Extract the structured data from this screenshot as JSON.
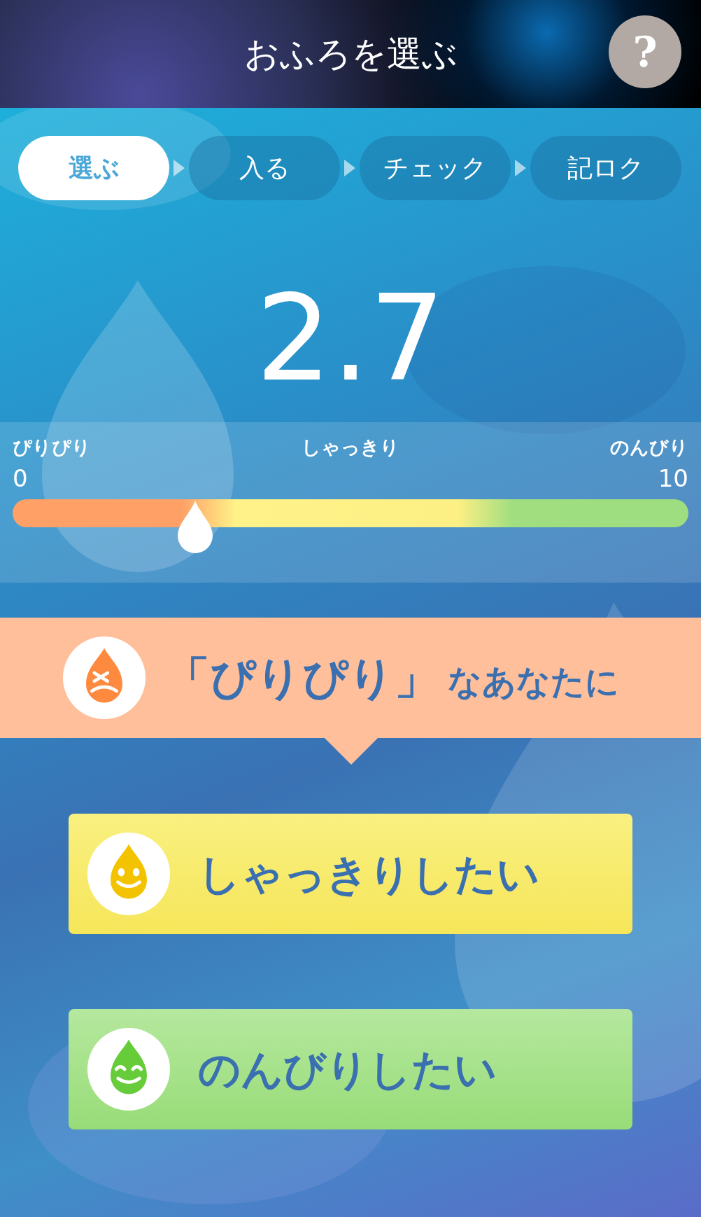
{
  "header": {
    "title": "おふろを選ぶ",
    "help": "?"
  },
  "steps": [
    {
      "label": "選ぶ",
      "selected": true
    },
    {
      "label": "入る",
      "selected": false
    },
    {
      "label": "チェック",
      "selected": false
    },
    {
      "label": "記ロク",
      "selected": false
    }
  ],
  "score": "2.7",
  "slider": {
    "labels": [
      "ぴりぴり",
      "しゃっきり",
      "のんびり"
    ],
    "min": "0",
    "max": "10",
    "level": 0.27
  },
  "banner": {
    "kind": "angry",
    "highlight": "「ぴりぴり」",
    "text": "なあなたに"
  },
  "choices": [
    {
      "label": "しゃっきりしたい",
      "kind": "happy"
    },
    {
      "label": "のんびりしたい",
      "kind": "calm"
    }
  ]
}
